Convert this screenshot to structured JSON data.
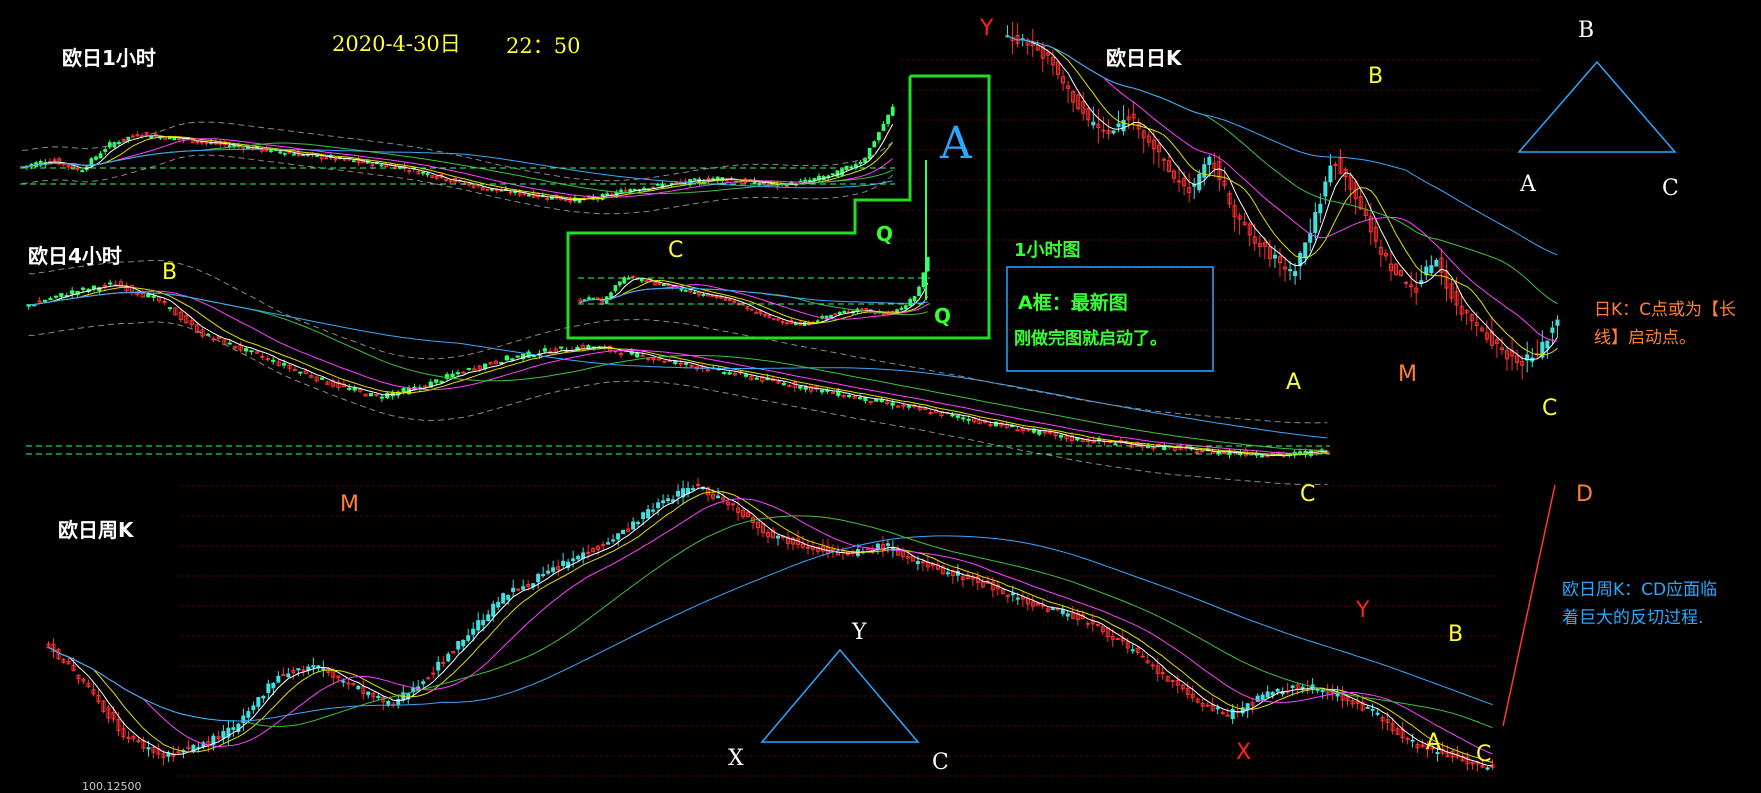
{
  "colors": {
    "background": "#000000",
    "bull": "#33ff66",
    "bull_daily": "#40e0e0",
    "bear": "#ff3030",
    "ma_white": "#ffffff",
    "ma_yellow": "#e0e000",
    "ma_magenta": "#ff40ff",
    "ma_green": "#40c040",
    "ma_blue": "#3aa8ff",
    "boll": "#888888",
    "grid": "#5a0000",
    "frame": "#22dd22",
    "callout_border": "#2aa8ff"
  },
  "header": {
    "date": "2020-4-30日",
    "time": "22：50"
  },
  "panels": {
    "h1_title": "欧日1小时",
    "h4_title": "欧日4小时",
    "daily_title": "欧日日K",
    "weekly_title": "欧日周K",
    "inset_title": "1小时图",
    "price_label": "100.12500"
  },
  "callouts": {
    "a_box_line1": "A框：最新图",
    "a_box_line2": "刚做完图就启动了。",
    "daily_note": "日K：C点或为【长线】启动点。",
    "weekly_note": "欧日周K：CD应面临着巨大的反切过程."
  },
  "points": {
    "h4_B": "B",
    "h4_C": "C",
    "inset_A": "A",
    "inset_C": "C",
    "inset_Q1": "Q",
    "inset_Q2": "Q",
    "daily_Y": "Y",
    "daily_B": "B",
    "daily_A": "A",
    "daily_M": "M",
    "daily_C": "C",
    "tri_top_B": "B",
    "tri_top_A": "A",
    "tri_top_C": "C",
    "weekly_M": "M",
    "weekly_D": "D",
    "weekly_Y_white": "Y",
    "weekly_X_white": "X",
    "weekly_C_white": "C",
    "weekly_Y_red": "Y",
    "weekly_X_red": "X",
    "weekly_B": "B",
    "weekly_A": "A",
    "weekly_C": "C"
  },
  "chart_data": [
    {
      "type": "line",
      "title": "欧日1小时",
      "series": [
        {
          "values": [
            117.9,
            118.0,
            117.85,
            118.2,
            118.35,
            118.3,
            118.25,
            118.2,
            118.15,
            118.1,
            118.05,
            118.0,
            117.95,
            117.9,
            117.8,
            117.7,
            117.6,
            117.55,
            117.5,
            117.45,
            117.5,
            117.6,
            117.65,
            117.7,
            117.75,
            117.7,
            117.65,
            117.7,
            117.8,
            118.0,
            118.7
          ]
        }
      ]
    },
    {
      "type": "line",
      "title": "欧日4小时",
      "series": [
        {
          "values": [
            121.5,
            121.8,
            122.0,
            121.6,
            120.8,
            120.4,
            120.0,
            119.6,
            119.3,
            119.5,
            119.9,
            120.2,
            120.4,
            120.5,
            120.3,
            120.1,
            119.9,
            119.7,
            119.5,
            119.3,
            119.1,
            118.9,
            118.7,
            118.5,
            118.3,
            118.2,
            118.1,
            118.0,
            117.95,
            117.9,
            118.0
          ]
        }
      ]
    },
    {
      "type": "line",
      "title": "欧日日K",
      "series": [
        {
          "values": [
            127.2,
            127.0,
            126.5,
            125.5,
            124.6,
            124.2,
            124.8,
            124.0,
            123.0,
            122.5,
            123.5,
            122.0,
            121.0,
            120.5,
            120.0,
            121.5,
            123.5,
            122.5,
            121.0,
            120.0,
            119.5,
            120.5,
            119.0,
            118.5,
            117.8,
            117.3,
            117.5,
            118.6
          ]
        }
      ]
    },
    {
      "type": "line",
      "title": "欧日周K",
      "series": [
        {
          "values": [
            124.0,
            122.0,
            119.5,
            118.5,
            119.0,
            120.0,
            122.5,
            123.0,
            122.0,
            121.0,
            122.5,
            124.5,
            126.5,
            127.5,
            128.5,
            129.5,
            131.0,
            132.0,
            131.0,
            129.5,
            129.0,
            128.5,
            129.0,
            128.0,
            127.5,
            126.8,
            126.0,
            125.5,
            124.5,
            123.0,
            121.5,
            120.5,
            121.5,
            122.0,
            121.5,
            120.5,
            119.0,
            118.5,
            117.8
          ]
        }
      ]
    }
  ]
}
